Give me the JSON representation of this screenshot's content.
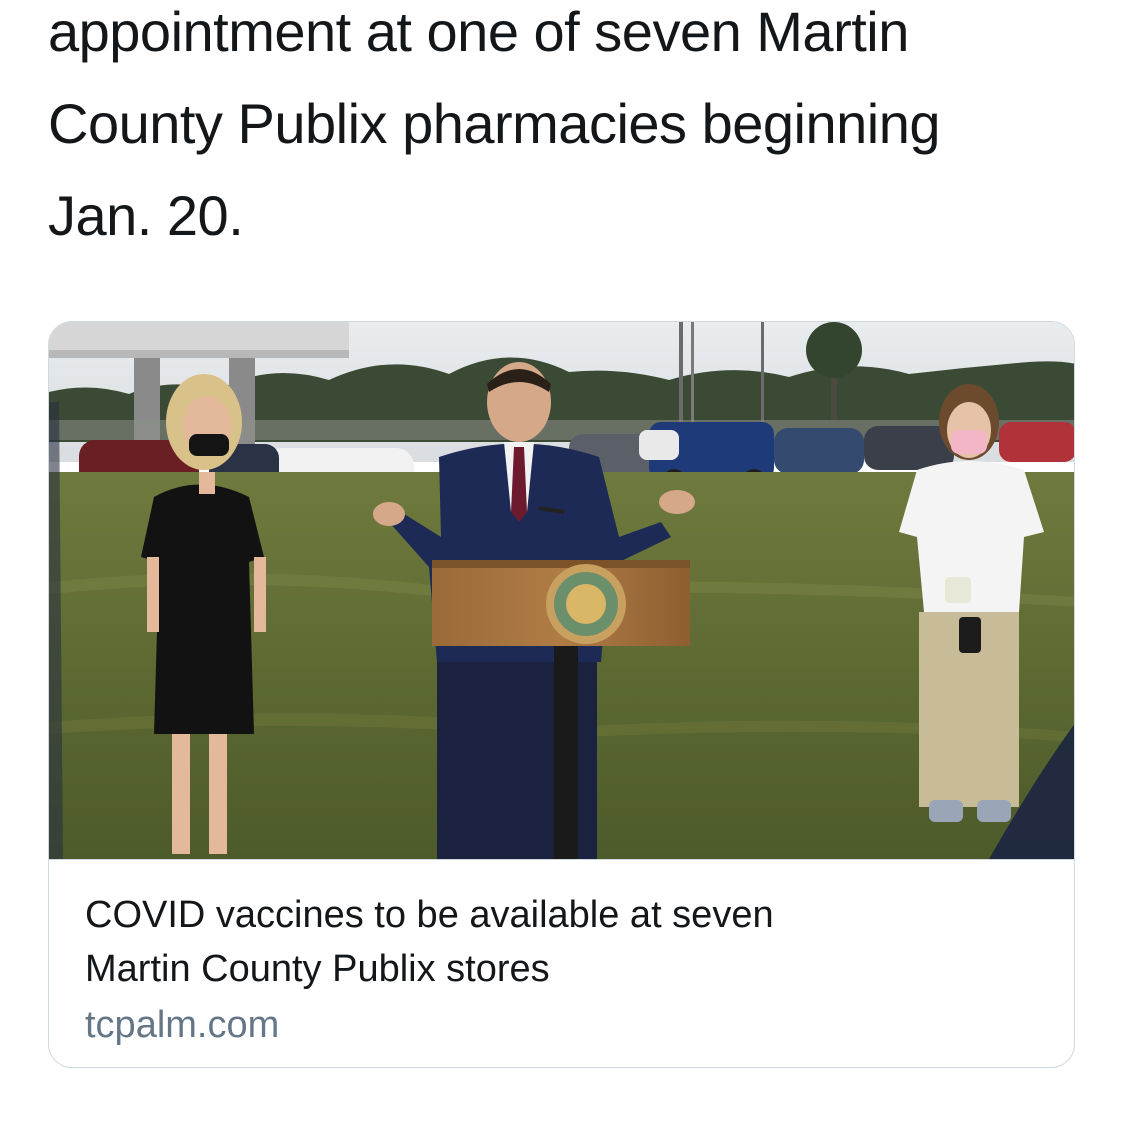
{
  "tweet": {
    "text_lines": [
      "appointment at one of seven Martin",
      "County Publix pharmacies beginning",
      "Jan. 20."
    ]
  },
  "card": {
    "image_icon": "press-conference-photo",
    "title_lines": [
      "COVID vaccines to be available at seven",
      "Martin County Publix stores"
    ],
    "domain": "tcpalm.com"
  },
  "colors": {
    "text": "#14171a",
    "secondary": "#657786",
    "border": "#cfd9de"
  }
}
